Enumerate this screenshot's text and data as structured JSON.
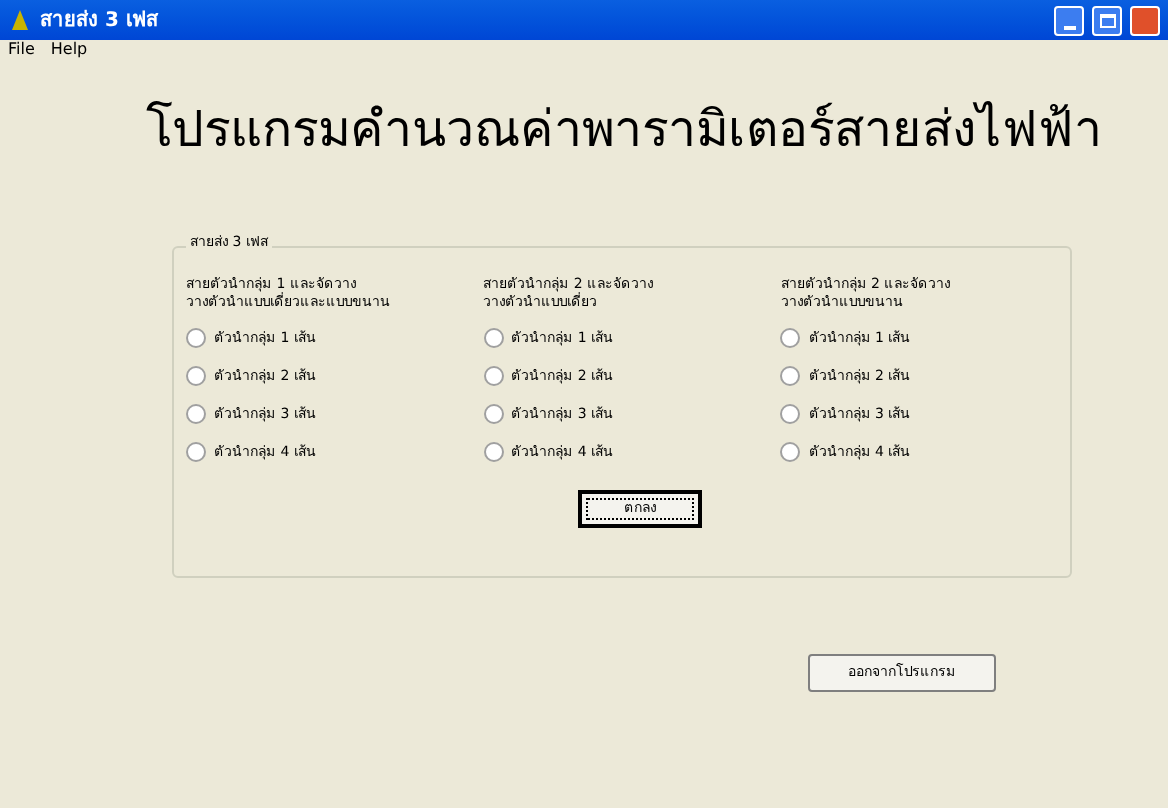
{
  "window": {
    "title": "สายส่ง 3 เฟส"
  },
  "menu": [
    "File",
    "Help"
  ],
  "heading": "โปรแกรมคำนวณค่าพารามิเตอร์สายส่งไฟฟ้า",
  "group": {
    "title": "สายส่ง 3 เฟส",
    "columns": [
      {
        "heading": [
          "สายตัวนำกลุ่ม 1 และจัดวาง",
          "วางตัวนำแบบเดี่ยวและแบบขนาน"
        ],
        "options": [
          {
            "label": "ตัวนำกลุ่ม 1 เส้น",
            "selected": false
          },
          {
            "label": "ตัวนำกลุ่ม 2 เส้น",
            "selected": false
          },
          {
            "label": "ตัวนำกลุ่ม 3 เส้น",
            "selected": false
          },
          {
            "label": "ตัวนำกลุ่ม 4 เส้น",
            "selected": false
          }
        ]
      },
      {
        "heading": [
          "สายตัวนำกลุ่ม 2 และจัดวาง",
          "วางตัวนำแบบเดี่ยว"
        ],
        "options": [
          {
            "label": "ตัวนำกลุ่ม 1 เส้น",
            "selected": false
          },
          {
            "label": "ตัวนำกลุ่ม 2 เส้น",
            "selected": false
          },
          {
            "label": "ตัวนำกลุ่ม 3 เส้น",
            "selected": false
          },
          {
            "label": "ตัวนำกลุ่ม 4 เส้น",
            "selected": false
          }
        ]
      },
      {
        "heading": [
          "สายตัวนำกลุ่ม 2 และจัดวาง",
          "วางตัวนำแบบขนาน"
        ],
        "options": [
          {
            "label": "ตัวนำกลุ่ม 1 เส้น",
            "selected": false
          },
          {
            "label": "ตัวนำกลุ่ม 2 เส้น",
            "selected": false
          },
          {
            "label": "ตัวนำกลุ่ม 3 เส้น",
            "selected": false
          },
          {
            "label": "ตัวนำกลุ่ม 4 เส้น",
            "selected": false
          }
        ]
      }
    ],
    "ok_button": "ตกลง"
  },
  "exit_button": "ออกจากโปรแกรม"
}
